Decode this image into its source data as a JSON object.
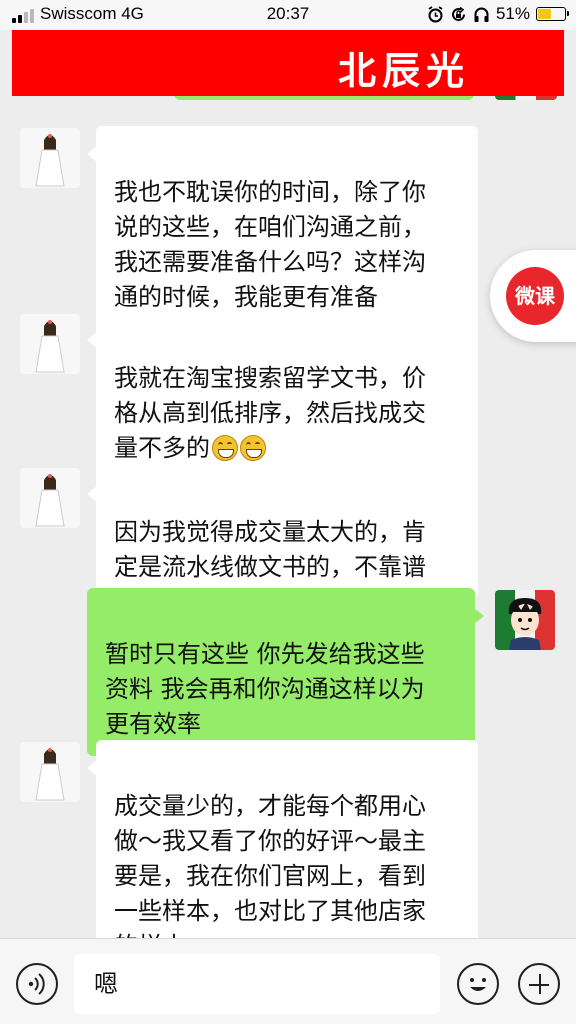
{
  "status_bar": {
    "carrier": "Swisscom 4G",
    "time": "20:37",
    "battery_percent": "51%",
    "battery_level": 0.51,
    "icons": [
      "alarm-icon",
      "rotation-lock-icon",
      "headphones-icon",
      "battery-icon"
    ]
  },
  "header": {
    "banner_title": "北辰光",
    "banner_color": "#ff0000"
  },
  "messages": [
    {
      "side": "left",
      "text": "我也不耽误你的时间，除了你\n说的这些，在咱们沟通之前，\n我还需要准备什么吗？这样沟\n通的时候，我能更有准备"
    },
    {
      "side": "left",
      "text": "我就在淘宝搜索留学文书，价\n格从高到低排序，然后找成交\n量不多的",
      "emoji_count": 2,
      "emoji": "grinning-face-icon"
    },
    {
      "side": "left",
      "text": "因为我觉得成交量太大的，肯\n定是流水线做文书的，不靠谱"
    },
    {
      "side": "right",
      "text": "暂时只有这些 你先发给我这些\n资料 我会再和你沟通这样以为\n更有效率"
    },
    {
      "side": "left",
      "text": "成交量少的，才能每个都用心\n做～我又看了你的好评～最主\n要是，我在你们官网上，看到\n一些样本，也对比了其他店家\n的样本"
    }
  ],
  "floating_button": {
    "label": "微课",
    "color": "#e8262b"
  },
  "input_bar": {
    "input_value": "嗯"
  },
  "colors": {
    "sent_bubble": "#95ec69",
    "received_bubble": "#ffffff",
    "background": "#ededed"
  }
}
